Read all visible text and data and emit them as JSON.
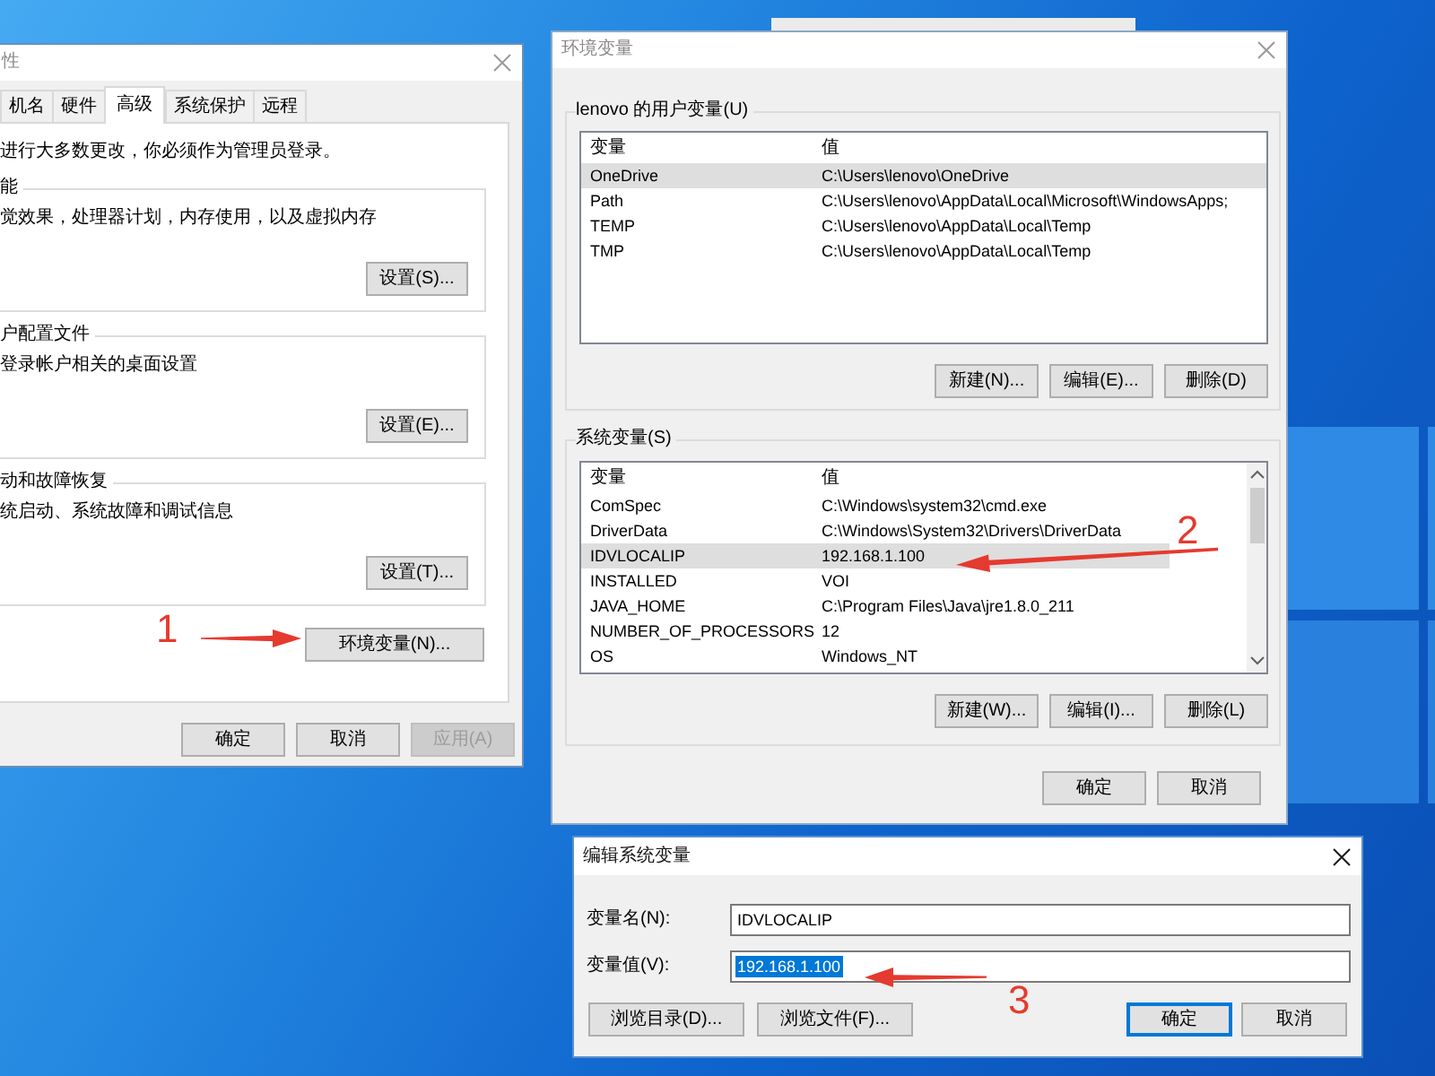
{
  "system_properties": {
    "title": "性",
    "active": false,
    "tabs": [
      {
        "label": "机名",
        "selected": false
      },
      {
        "label": "硬件",
        "selected": false
      },
      {
        "label": "高级",
        "selected": true
      },
      {
        "label": "系统保护",
        "selected": false
      },
      {
        "label": "远程",
        "selected": false
      }
    ],
    "notice": "进行大多数更改，你必须作为管理员登录。",
    "groups": [
      {
        "label": "能",
        "description": "觉效果，处理器计划，内存使用，以及虚拟内存",
        "button": "设置(S)..."
      },
      {
        "label": "户配置文件",
        "description": "登录帐户相关的桌面设置",
        "button": "设置(E)..."
      },
      {
        "label": "动和故障恢复",
        "description": "统启动、系统故障和调试信息",
        "button": "设置(T)..."
      }
    ],
    "environment_button": "环境变量(N)...",
    "buttons": [
      {
        "label": "确定",
        "disabled": false
      },
      {
        "label": "取消",
        "disabled": false
      },
      {
        "label": "应用(A)",
        "disabled": true
      }
    ]
  },
  "environment_variables": {
    "title": "环境变量",
    "active": false,
    "groups": [
      {
        "label": "lenovo 的用户变量(U)",
        "columns": [
          "变量",
          "值"
        ],
        "rows": [
          {
            "name": "OneDrive",
            "value": "C:\\Users\\lenovo\\OneDrive",
            "selected": true
          },
          {
            "name": "Path",
            "value": "C:\\Users\\lenovo\\AppData\\Local\\Microsoft\\WindowsApps;",
            "selected": false
          },
          {
            "name": "TEMP",
            "value": "C:\\Users\\lenovo\\AppData\\Local\\Temp",
            "selected": false
          },
          {
            "name": "TMP",
            "value": "C:\\Users\\lenovo\\AppData\\Local\\Temp",
            "selected": false
          }
        ],
        "buttons": [
          "新建(N)...",
          "编辑(E)...",
          "删除(D)"
        ]
      },
      {
        "label": "系统变量(S)",
        "columns": [
          "变量",
          "值"
        ],
        "rows": [
          {
            "name": "ComSpec",
            "value": "C:\\Windows\\system32\\cmd.exe",
            "selected": false
          },
          {
            "name": "DriverData",
            "value": "C:\\Windows\\System32\\Drivers\\DriverData",
            "selected": false
          },
          {
            "name": "IDVLOCALIP",
            "value": "192.168.1.100",
            "selected": true
          },
          {
            "name": "INSTALLED",
            "value": "VOI",
            "selected": false
          },
          {
            "name": "JAVA_HOME",
            "value": "C:\\Program Files\\Java\\jre1.8.0_211",
            "selected": false
          },
          {
            "name": "NUMBER_OF_PROCESSORS",
            "value": "12",
            "selected": false
          },
          {
            "name": "OS",
            "value": "Windows_NT",
            "selected": false
          }
        ],
        "buttons": [
          "新建(W)...",
          "编辑(I)...",
          "删除(L)"
        ]
      }
    ],
    "buttons": [
      "确定",
      "取消"
    ]
  },
  "edit_dialog": {
    "title": "编辑系统变量",
    "active": true,
    "fields": [
      {
        "label": "变量名(N):",
        "value": "IDVLOCALIP",
        "text_selected": false
      },
      {
        "label": "变量值(V):",
        "value": "192.168.1.100",
        "text_selected": true
      }
    ],
    "browse_buttons": [
      "浏览目录(D)...",
      "浏览文件(F)..."
    ],
    "buttons": [
      {
        "label": "确定",
        "default": true
      },
      {
        "label": "取消",
        "default": false
      }
    ]
  },
  "annotations": [
    {
      "label": "1"
    },
    {
      "label": "2"
    },
    {
      "label": "3"
    }
  ]
}
